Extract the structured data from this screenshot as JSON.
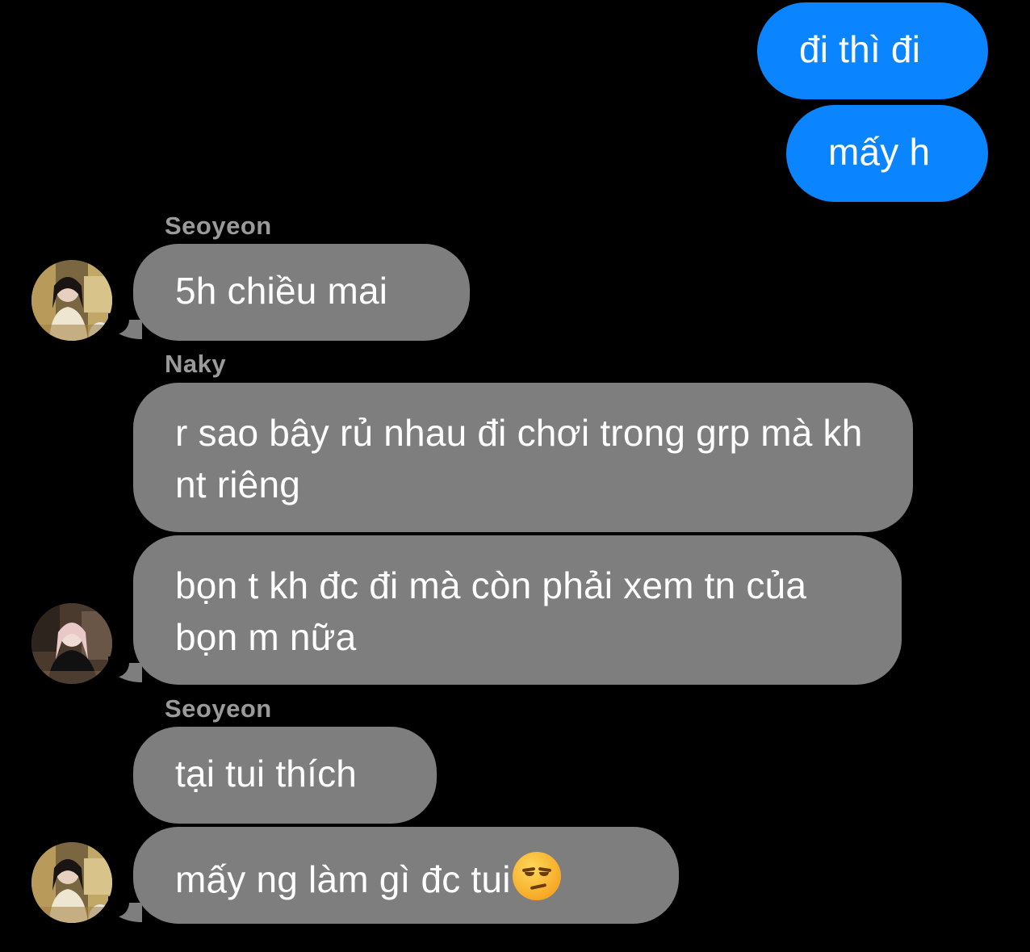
{
  "messages": {
    "out_1": "đi thì đi",
    "out_2": "mấy h",
    "sender_1": "Seoyeon",
    "in_1": "5h chiều mai",
    "sender_2": "Naky",
    "in_2": "r sao bây rủ nhau đi chơi trong grp mà kh nt riêng",
    "in_3": "bọn t kh đc đi mà còn phải xem tn của bọn m nữa",
    "sender_3": "Seoyeon",
    "in_4": "tại tui thích",
    "in_5": "mấy ng làm gì đc tui"
  },
  "emoji": "unamused-face-icon",
  "colors": {
    "background": "#000000",
    "outgoing_bubble": "#0a84ff",
    "incoming_bubble": "#7e7e7e",
    "sender_name": "#9a9a9a"
  }
}
